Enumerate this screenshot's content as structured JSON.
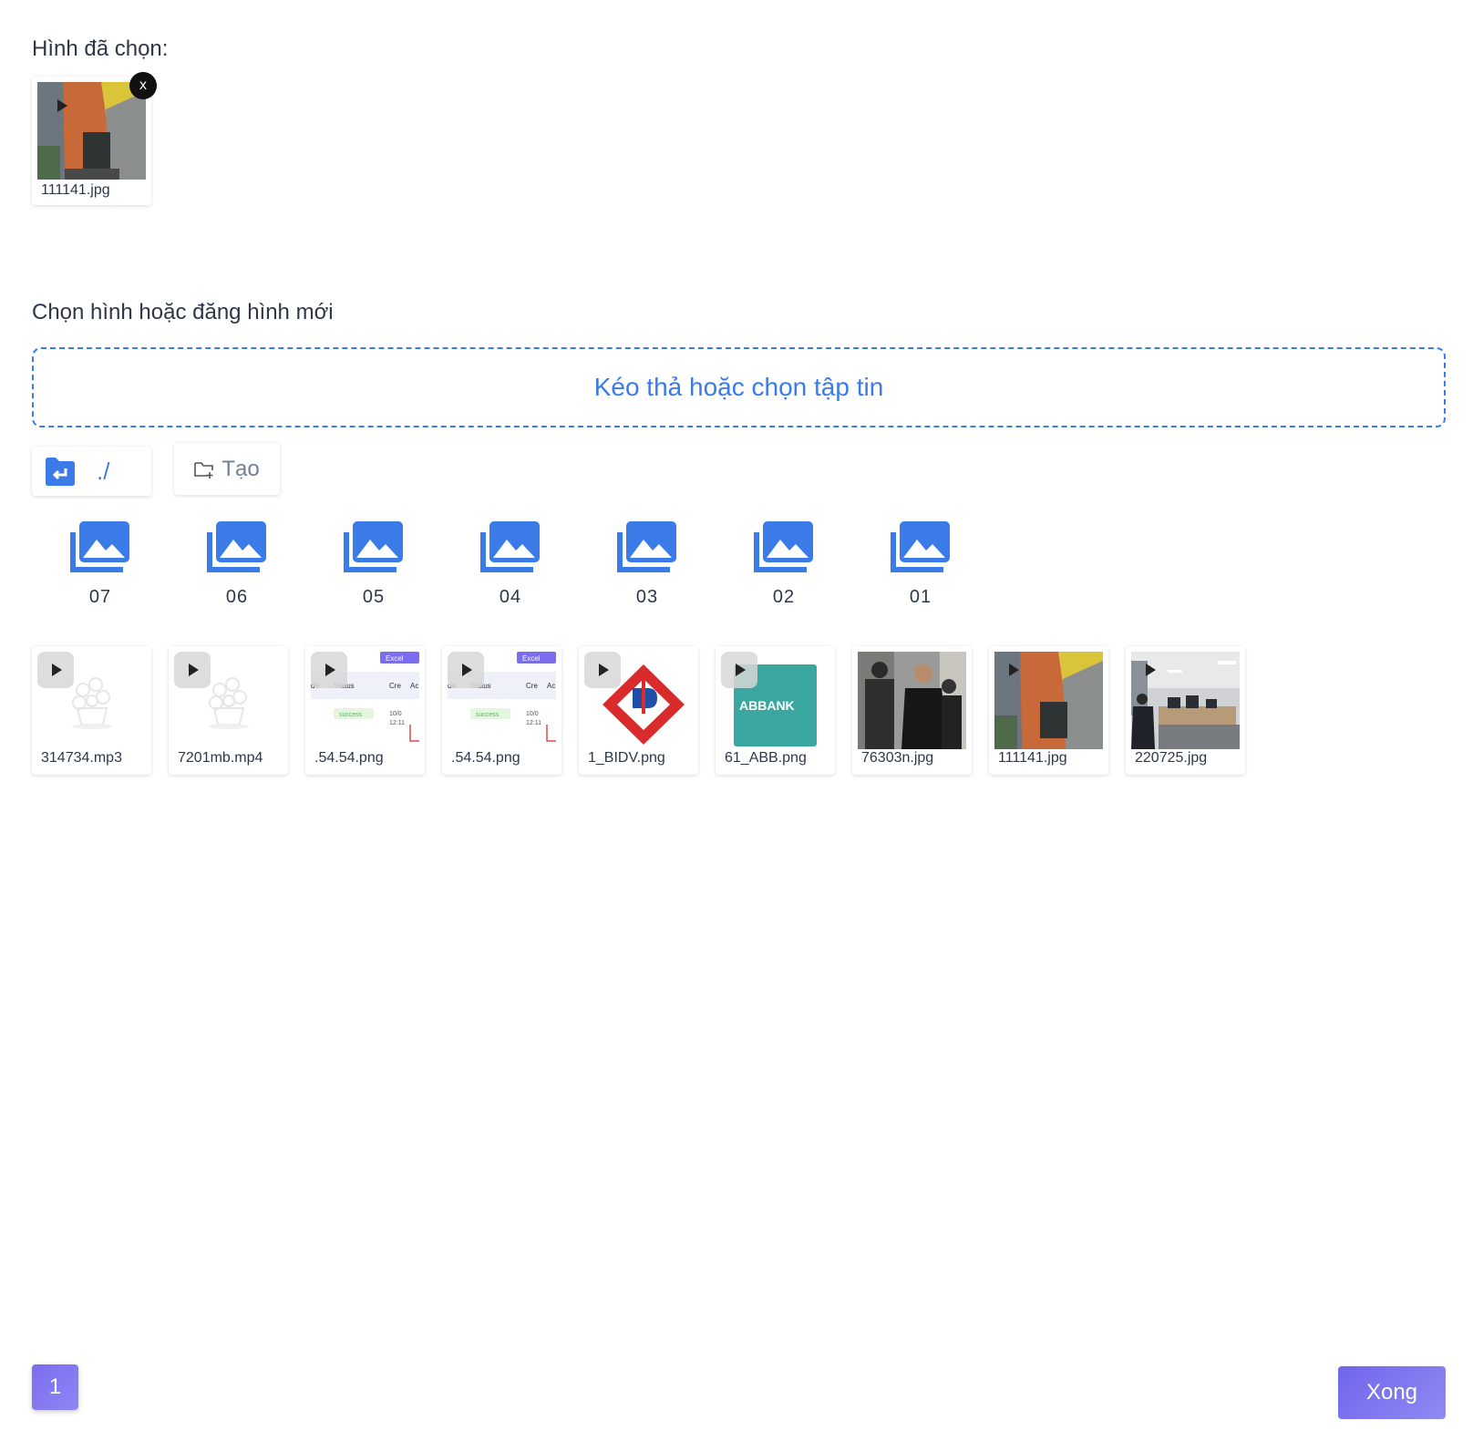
{
  "selected": {
    "title": "Hình đã chọn:",
    "item": {
      "name": "111141.jpg",
      "remove_label": "x"
    }
  },
  "browser": {
    "title": "Chọn hình hoặc đăng hình mới",
    "dropzone_label": "Kéo thả hoặc chọn tập tin",
    "path": "./",
    "create_label": "Tạo",
    "folders": [
      "07",
      "06",
      "05",
      "04",
      "03",
      "02",
      "01"
    ],
    "files": [
      {
        "name": "314734.mp3",
        "icon": "plant-placeholder-icon"
      },
      {
        "name": "7201mb.mp4",
        "icon": "plant-placeholder-icon"
      },
      {
        "name": ".54.54.png",
        "icon": "table-screenshot"
      },
      {
        "name": ".54.54.png",
        "icon": "table-screenshot"
      },
      {
        "name": "1_BIDV.png",
        "icon": "bidv-logo"
      },
      {
        "name": "61_ABB.png",
        "icon": "abbank-logo"
      },
      {
        "name": "76303n.jpg",
        "icon": "people-photo"
      },
      {
        "name": "111141.jpg",
        "icon": "office-hallway-photo"
      },
      {
        "name": "220725.jpg",
        "icon": "office-room-photo"
      }
    ],
    "thumb_text": {
      "excel": "Excel",
      "status": "Status",
      "cre": "Cre",
      "ac": "Ac",
      "de": "de",
      "success": "success",
      "date": "10/0",
      "time": "12:11",
      "abbank": "ABBANK"
    }
  },
  "pagination": {
    "current": "1"
  },
  "done_label": "Xong",
  "colors": {
    "accent": "#3b7be8",
    "primary": "#7b6cf0"
  }
}
